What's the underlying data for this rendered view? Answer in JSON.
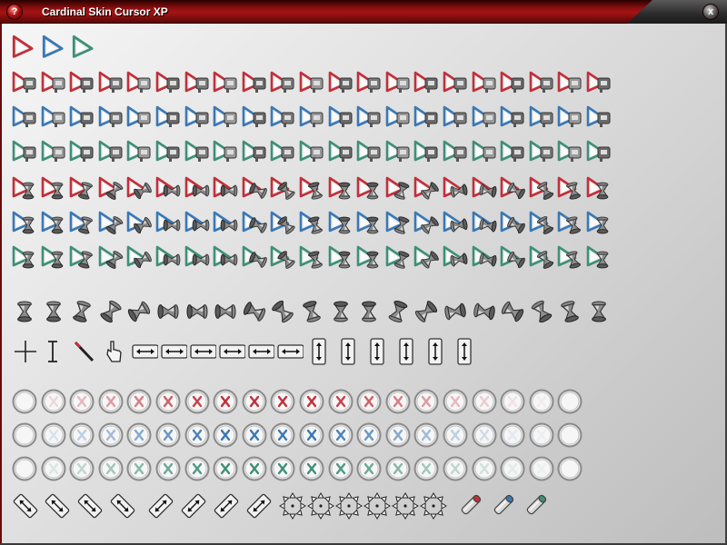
{
  "window": {
    "title": "Cardinal Skin Cursor XP",
    "help_glyph": "?",
    "close_glyph": "x"
  },
  "colors": {
    "title_red": "#a31515",
    "red": "#c0303a",
    "blue": "#3a78b4",
    "green": "#3f8f78",
    "chrome": "#9a9a9a"
  },
  "color_order": [
    "red",
    "blue",
    "green"
  ],
  "arrows": [
    "arrow-red",
    "arrow-blue",
    "arrow-green"
  ],
  "help_cursors": {
    "description_icon": "arrow-with-help-badge",
    "rows": [
      "red",
      "blue",
      "green"
    ],
    "count_per_row": 21
  },
  "busy_cursors": {
    "description_icon": "arrow-with-hourglass",
    "rows": [
      "red",
      "blue",
      "green"
    ],
    "count_per_row": 21
  },
  "hourglass_frames": {
    "icon": "hourglass-animation-frame",
    "count": 21
  },
  "misc_cursors": [
    "crosshair-icon",
    "text-beam-icon",
    "handwriting-pen-icon",
    "link-hand-icon",
    "horizontal-resize-icon",
    "horizontal-resize-icon",
    "horizontal-resize-icon",
    "horizontal-resize-icon",
    "horizontal-resize-icon",
    "horizontal-resize-icon",
    "vertical-resize-icon",
    "vertical-resize-icon",
    "vertical-resize-icon",
    "vertical-resize-icon",
    "vertical-resize-icon",
    "vertical-resize-icon"
  ],
  "unavailable_cursors": {
    "icon": "unavailable-circle-icon",
    "rows": [
      "red",
      "blue",
      "green"
    ],
    "count_per_row": 20
  },
  "bottom_row": [
    "diagonal-resize-nwse-icon",
    "diagonal-resize-nwse-icon",
    "diagonal-resize-nwse-icon",
    "diagonal-resize-nwse-icon",
    "diagonal-resize-nesw-icon",
    "diagonal-resize-nesw-icon",
    "diagonal-resize-nesw-icon",
    "diagonal-resize-nesw-icon",
    "move-four-way-icon",
    "move-four-way-icon",
    "move-four-way-icon",
    "move-four-way-icon",
    "move-four-way-icon",
    "move-four-way-icon",
    "alternate-select-red-icon",
    "alternate-select-blue-icon",
    "alternate-select-green-icon"
  ]
}
